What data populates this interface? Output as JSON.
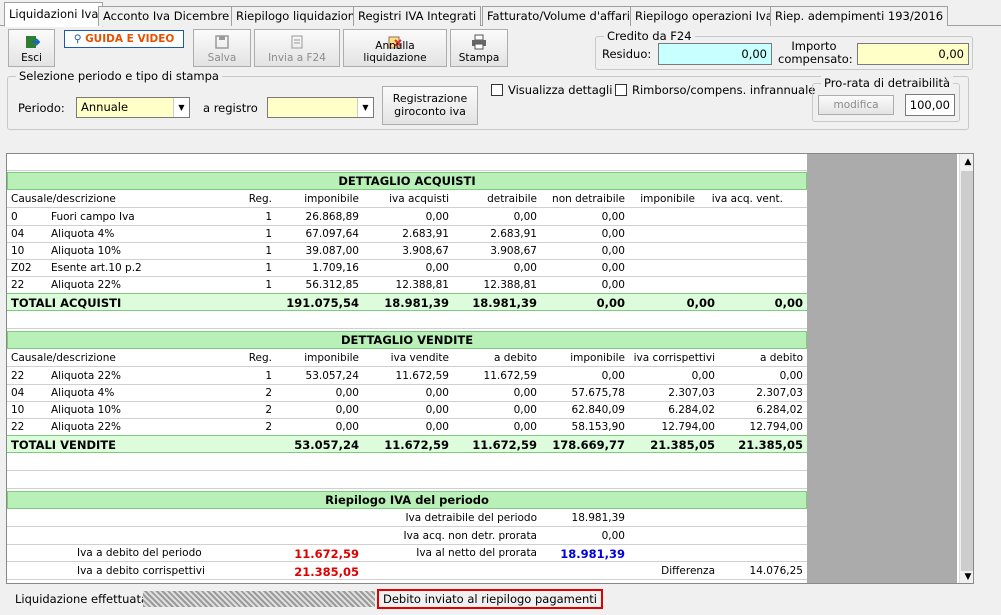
{
  "tabs": [
    "Liquidazioni Iva",
    "Acconto Iva Dicembre",
    "Riepilogo liquidazioni",
    "Registri IVA Integrati",
    "Fatturato/Volume d'affari",
    "Riepilogo operazioni Iva",
    "Riep. adempimenti 193/2016"
  ],
  "toolbar": {
    "esci": "Esci",
    "guida": "GUIDA E VIDEO",
    "salva": "Salva",
    "invia": "Invia a F24",
    "annulla": "Annulla liquidazione",
    "stampa": "Stampa"
  },
  "credito": {
    "title": "Credito da F24",
    "residuo_label": "Residuo:",
    "residuo_value": "0,00",
    "importo_label": "Importo compensato:",
    "importo_value": "0,00"
  },
  "selezione": {
    "title": "Selezione periodo e tipo di stampa",
    "periodo_label": "Periodo:",
    "periodo_value": "Annuale",
    "registro_label": "a registro",
    "registro_value": "",
    "registrazione_btn": "Registrazione giroconto iva"
  },
  "checks": {
    "dettagli": "Visualizza dettagli",
    "rimborso": "Rimborso/compens. infrannuale"
  },
  "prorata": {
    "title": "Pro-rata di detraibilità",
    "modifica": "modifica",
    "value": "100,00"
  },
  "acquisti": {
    "title": "DETTAGLIO ACQUISTI",
    "headers": [
      "Causale/descrizione",
      "Reg.",
      "imponibile",
      "iva acquisti",
      "detraibile",
      "non detraibile",
      "imponibile",
      "iva acq. vent."
    ],
    "rows": [
      [
        "0",
        "Fuori campo Iva",
        "1",
        "26.868,89",
        "0,00",
        "0,00",
        "0,00"
      ],
      [
        "04",
        "Aliquota 4%",
        "1",
        "67.097,64",
        "2.683,91",
        "2.683,91",
        "0,00"
      ],
      [
        "10",
        "Aliquota 10%",
        "1",
        "39.087,00",
        "3.908,67",
        "3.908,67",
        "0,00"
      ],
      [
        "Z02",
        "Esente art.10 p.2",
        "1",
        "1.709,16",
        "0,00",
        "0,00",
        "0,00"
      ],
      [
        "22",
        "Aliquota 22%",
        "1",
        "56.312,85",
        "12.388,81",
        "12.388,81",
        "0,00"
      ]
    ],
    "totals": [
      "TOTALI ACQUISTI",
      "191.075,54",
      "18.981,39",
      "18.981,39",
      "0,00",
      "0,00",
      "0,00"
    ]
  },
  "vendite": {
    "title": "DETTAGLIO VENDITE",
    "headers": [
      "Causale/descrizione",
      "Reg.",
      "imponibile",
      "iva vendite",
      "a debito",
      "imponibile",
      "iva corrispettivi",
      "a debito"
    ],
    "rows": [
      [
        "22",
        "Aliquota 22%",
        "1",
        "53.057,24",
        "11.672,59",
        "11.672,59",
        "0,00",
        "0,00",
        "0,00"
      ],
      [
        "04",
        "Aliquota 4%",
        "2",
        "0,00",
        "0,00",
        "0,00",
        "57.675,78",
        "2.307,03",
        "2.307,03"
      ],
      [
        "10",
        "Aliquota 10%",
        "2",
        "0,00",
        "0,00",
        "0,00",
        "62.840,09",
        "6.284,02",
        "6.284,02"
      ],
      [
        "22",
        "Aliquota 22%",
        "2",
        "0,00",
        "0,00",
        "0,00",
        "58.153,90",
        "12.794,00",
        "12.794,00"
      ]
    ],
    "totals": [
      "TOTALI VENDITE",
      "53.057,24",
      "11.672,59",
      "11.672,59",
      "178.669,77",
      "21.385,05",
      "21.385,05"
    ]
  },
  "riepilogo": {
    "title": "Riepilogo IVA del periodo",
    "detraibile_label": "Iva detraibile del periodo",
    "detraibile_value": "18.981,39",
    "nondetr_label": "Iva acq. non detr. prorata",
    "nondetr_value": "0,00",
    "debito_label": "Iva a debito del periodo",
    "debito_value": "11.672,59",
    "netto_label": "Iva al netto del prorata",
    "netto_value": "18.981,39",
    "corrisp_label": "Iva a debito corrispettivi",
    "corrisp_value": "21.385,05",
    "differenza_label": "Differenza",
    "differenza_value": "14.076,25"
  },
  "status": {
    "text": "Liquidazione effettuata",
    "badge": "Debito inviato al riepilogo pagamenti"
  },
  "colors": {
    "green": "#b8f0b8",
    "red": "#e00000",
    "blue": "#0000e0",
    "badge_border": "#e00000"
  }
}
